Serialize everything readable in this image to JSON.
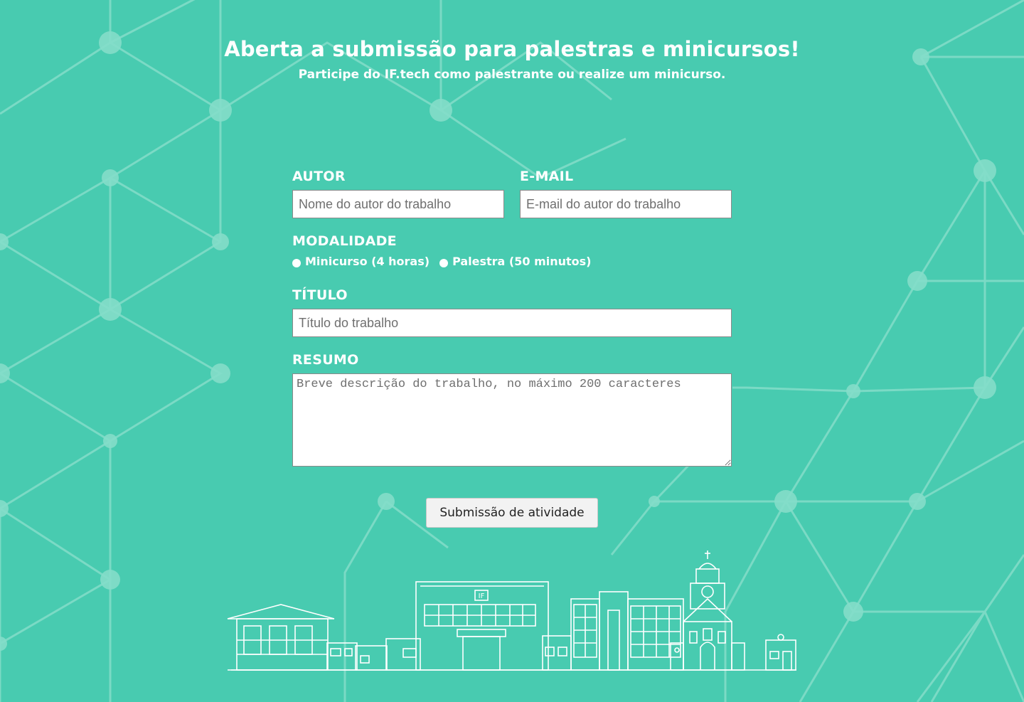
{
  "header": {
    "title": "Aberta a submissão para palestras e minicursos!",
    "subtitle": "Participe do IF.tech como palestrante ou realize um minicurso."
  },
  "form": {
    "author": {
      "label": "AUTOR",
      "placeholder": "Nome do autor do trabalho"
    },
    "email": {
      "label": "E-MAIL",
      "placeholder": "E-mail do autor do trabalho"
    },
    "modality": {
      "label": "MODALIDADE",
      "options": [
        "Minicurso (4 horas)",
        "Palestra (50 minutos)"
      ]
    },
    "title": {
      "label": "TÍTULO",
      "placeholder": "Título do trabalho"
    },
    "summary": {
      "label": "RESUMO",
      "placeholder": "Breve descrição do trabalho, no máximo 200 caracteres"
    },
    "submit_label": "Submissão de atividade"
  },
  "illustration": {
    "building_sign": "IF"
  },
  "colors": {
    "background": "#48CBB0",
    "network": "#7FDCC8",
    "text": "#FFFFFF"
  }
}
